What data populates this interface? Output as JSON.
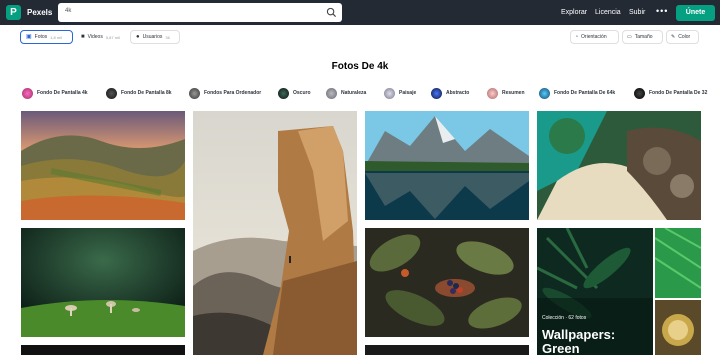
{
  "header": {
    "brand": "Pexels",
    "search_value": "4k",
    "nav": [
      "Explorar",
      "Licencia",
      "Subir"
    ],
    "more": "•••",
    "join_label": "Únete"
  },
  "tabs": [
    {
      "label": "Fotos",
      "count": "1,8 mil",
      "icon": "photo-icon",
      "active": true
    },
    {
      "label": "Videos",
      "count": "5,87 mil",
      "icon": "video-icon",
      "active": false
    },
    {
      "label": "Usuarios",
      "count": "36",
      "icon": "user-icon",
      "active": false
    }
  ],
  "tools": [
    {
      "label": "Orientación",
      "icon": "orientation-icon"
    },
    {
      "label": "Tamaño",
      "icon": "size-icon"
    },
    {
      "label": "Color",
      "icon": "color-icon"
    }
  ],
  "page_title": "Fotos De 4k",
  "chips": [
    "Fondo De Pantalla 4k",
    "Fondo De Pantalla 8k",
    "Fondos Para Ordenador",
    "Oscuro",
    "Naturaleza",
    "Paisaje",
    "Abstracto",
    "Resumen",
    "Fondo De Pantalla De 64k",
    "Fondo De Pantalla De 32"
  ],
  "collection": {
    "label": "Colección · 62 fotos",
    "title": "Wallpapers: Green"
  },
  "colors": {
    "header_bg": "#232a34",
    "brand_green": "#05a081",
    "active_tab": "#2a66d6"
  }
}
